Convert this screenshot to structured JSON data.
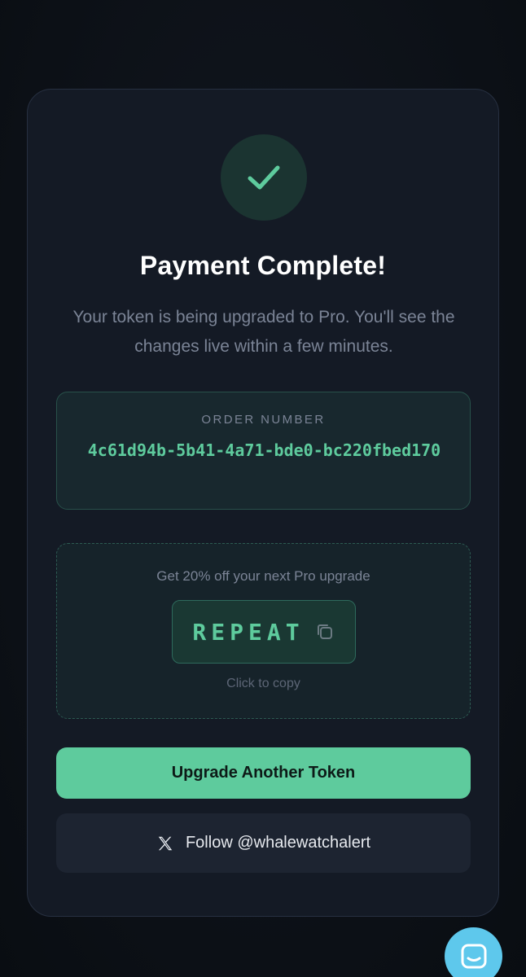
{
  "success": {
    "icon": "check-icon",
    "title": "Payment Complete!",
    "message": "Your token is being upgraded to Pro. You'll see the changes live within a few minutes."
  },
  "order": {
    "label": "ORDER NUMBER",
    "number": "4c61d94b-5b41-4a71-bde0-bc220fbed170"
  },
  "promo": {
    "text": "Get 20% off your next Pro upgrade",
    "code": "REPEAT",
    "copy_icon": "copy-icon",
    "hint": "Click to copy"
  },
  "actions": {
    "primary_label": "Upgrade Another Token",
    "follow_label": "Follow @whalewatchalert",
    "follow_icon": "x-logo-icon"
  },
  "chat": {
    "icon": "chat-icon"
  },
  "colors": {
    "accent": "#5ecb9d",
    "background": "#0d1117",
    "card": "#141a25",
    "chat": "#5ec8ec"
  }
}
